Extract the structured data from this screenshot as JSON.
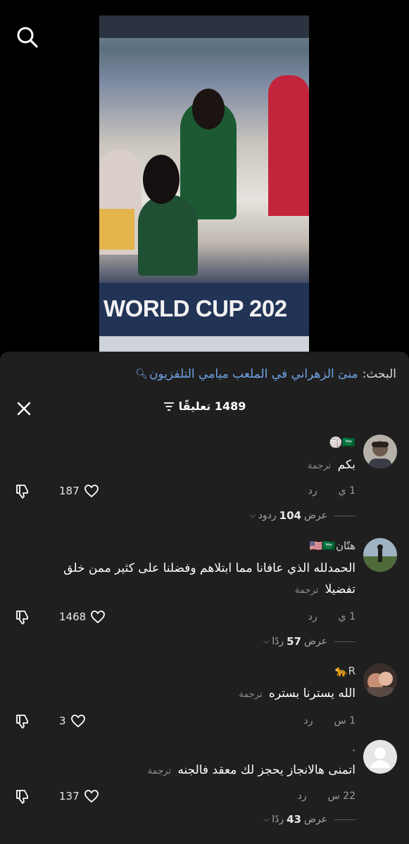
{
  "search": {
    "label": "البحث:",
    "query": "منىَ الزهراني في الملعب ميامي التلفزيون"
  },
  "video": {
    "banner_text": "WORLD CUP 202"
  },
  "comments_header": {
    "count_text": "1489 تعليقًا"
  },
  "comments": [
    {
      "username": "🇸🇦🏐",
      "text": "بكم",
      "translate": "ترجمة",
      "time": "1 ي",
      "reply": "رد",
      "likes": "187",
      "replies_prefix": "عرض",
      "replies_count": "104",
      "replies_suffix": "ردود"
    },
    {
      "username": "هتّان🇺🇸🇸🇦",
      "text": "الحمدلله الذي عافانا مما ابتلاهم وفضلنا على كثير ممن خلق تفضيلا",
      "translate": "ترجمة",
      "time": "1 ي",
      "reply": "رد",
      "likes": "1468",
      "replies_prefix": "عرض",
      "replies_count": "57",
      "replies_suffix": "ردًا"
    },
    {
      "username": "R🐆",
      "text": "الله يسترنا بستره",
      "translate": "ترجمة",
      "time": "1 س",
      "reply": "رد",
      "likes": "3"
    },
    {
      "username": ".",
      "text": "اتمنى هالانجاز يحجز لك معقد فالجنه",
      "translate": "ترجمة",
      "time": "22 س",
      "reply": "رد",
      "likes": "137",
      "replies_prefix": "عرض",
      "replies_count": "43",
      "replies_suffix": "ردًا"
    }
  ],
  "icons": {
    "search": "search-icon",
    "close": "close-icon",
    "filter": "filter-icon",
    "heart": "heart-icon",
    "dislike": "dislike-icon"
  },
  "colors": {
    "accent_link": "#6fa4e8",
    "sheet_bg": "#1f1f1f"
  }
}
